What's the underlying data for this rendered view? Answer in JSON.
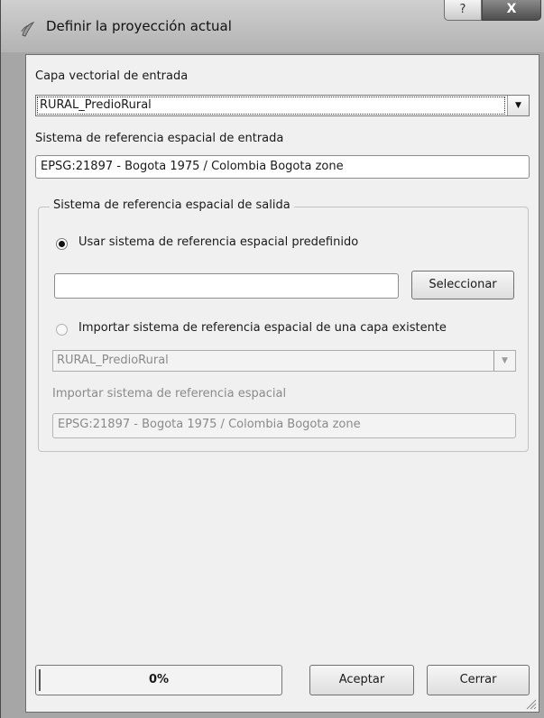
{
  "window": {
    "title": "Definir la proyección actual",
    "help_glyph": "?",
    "close_glyph": "X"
  },
  "input_layer": {
    "label": "Capa vectorial de entrada",
    "value": "RURAL_PredioRural"
  },
  "input_crs": {
    "label": "Sistema de referencia espacial de entrada",
    "value": "EPSG:21897 - Bogota 1975 / Colombia Bogota zone"
  },
  "output_crs": {
    "group_title": "Sistema de referencia espacial de salida",
    "predefined_option": "Usar sistema de referencia espacial predefinido",
    "predefined_selected": true,
    "predefined_value": "",
    "select_button": "Seleccionar",
    "import_option": "Importar sistema de referencia espacial de una capa existente",
    "import_layer_value": "RURAL_PredioRural",
    "import_crs_label": "Importar sistema de referencia espacial",
    "import_crs_value": "EPSG:21897 - Bogota 1975 / Colombia Bogota zone"
  },
  "footer": {
    "progress_text": "0%",
    "progress_fraction": 0,
    "accept_button": "Aceptar",
    "close_button": "Cerrar"
  },
  "icons": {
    "title": "qgis-plugin-icon",
    "dropdown": "chevron-down-icon",
    "grip": "resize-grip-icon"
  }
}
